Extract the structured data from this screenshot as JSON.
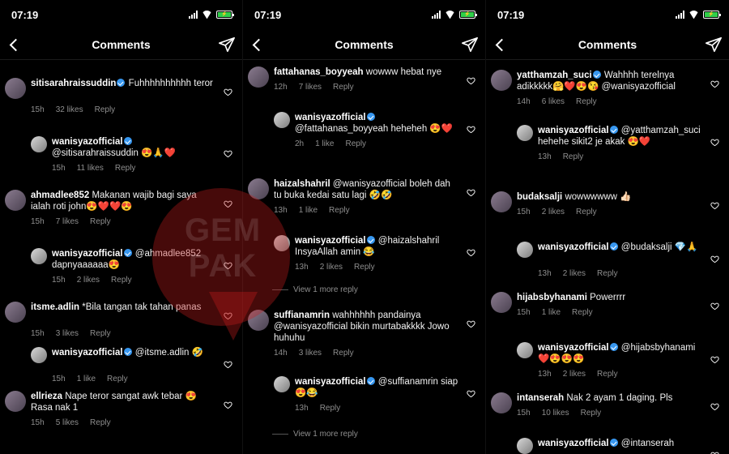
{
  "status": {
    "time": "07:19",
    "battery": "⚡"
  },
  "header": {
    "title": "Comments"
  },
  "watermark": {
    "line1": "GEM",
    "line2": "PAK"
  },
  "panels": [
    {
      "items": [
        {
          "type": "comment",
          "user": "sitisarahraissuddin",
          "verified": true,
          "text": "Fuhhhhhhhhhh teror",
          "time": "15h",
          "likes": "32 likes",
          "reply": "Reply"
        },
        {
          "type": "reply",
          "user": "wanisyazofficial",
          "verified": true,
          "text": "@sitisarahraissuddin 😍🙏❤️",
          "time": "15h",
          "likes": "11 likes",
          "reply": "Reply"
        },
        {
          "type": "comment",
          "user": "ahmadlee852",
          "verified": false,
          "text": "Makanan wajib bagi saya ialah roti john😍❤️❤️😍",
          "time": "15h",
          "likes": "7 likes",
          "reply": "Reply"
        },
        {
          "type": "reply",
          "user": "wanisyazofficial",
          "verified": true,
          "text": "@ahmadlee852 dapnyaaaaaa😍",
          "time": "15h",
          "likes": "2 likes",
          "reply": "Reply"
        },
        {
          "type": "comment",
          "user": "itsme.adlin",
          "verified": false,
          "text": "*Bila tangan tak tahan panas",
          "time": "15h",
          "likes": "3 likes",
          "reply": "Reply"
        },
        {
          "type": "reply",
          "user": "wanisyazofficial",
          "verified": true,
          "text": "@itsme.adlin 🤣",
          "time": "15h",
          "likes": "1 like",
          "reply": "Reply"
        },
        {
          "type": "comment",
          "user": "ellrieza",
          "verified": false,
          "text": "Nape teror sangat awk tebar 😍 Rasa nak 1",
          "time": "15h",
          "likes": "5 likes",
          "reply": "Reply"
        }
      ]
    },
    {
      "items": [
        {
          "type": "comment",
          "user": "fattahanas_boyyeah",
          "verified": false,
          "text": "wowww hebat nye",
          "time": "12h",
          "likes": "7 likes",
          "reply": "Reply"
        },
        {
          "type": "reply",
          "user": "wanisyazofficial",
          "verified": true,
          "text": "@fattahanas_boyyeah heheheh 😍❤️",
          "time": "2h",
          "likes": "1 like",
          "reply": "Reply"
        },
        {
          "type": "comment",
          "user": "haizalshahril",
          "verified": false,
          "text": "@wanisyazofficial  boleh dah tu buka kedai satu lagi 🤣🤣",
          "time": "13h",
          "likes": "1 like",
          "reply": "Reply"
        },
        {
          "type": "reply",
          "user": "wanisyazofficial",
          "verified": true,
          "text": "@haizalshahril InsyaAllah amin 😂",
          "time": "13h",
          "likes": "2 likes",
          "reply": "Reply"
        },
        {
          "type": "viewmore",
          "text": "View 1 more reply"
        },
        {
          "type": "comment",
          "user": "suffianamrin",
          "verified": false,
          "text": "wahhhhhh pandainya @wanisyazofficial bikin murtabakkkk Jowo huhuhu",
          "time": "14h",
          "likes": "3 likes",
          "reply": "Reply"
        },
        {
          "type": "reply",
          "user": "wanisyazofficial",
          "verified": true,
          "text": "@suffianamrin siap 😍😂",
          "time": "13h",
          "likes": "",
          "reply": "Reply"
        },
        {
          "type": "viewmore",
          "text": "View 1 more reply"
        }
      ]
    },
    {
      "items": [
        {
          "type": "comment",
          "user": "yatthamzah_suci",
          "verified": true,
          "text": "Wahhhh terelnya adikkkkk🤗❤️😍😘 @wanisyazofficial",
          "time": "14h",
          "likes": "6 likes",
          "reply": "Reply"
        },
        {
          "type": "reply",
          "user": "wanisyazofficial",
          "verified": true,
          "text": "@yatthamzah_suci hehehe sikit2 je akak 😍❤️",
          "time": "13h",
          "likes": "",
          "reply": "Reply"
        },
        {
          "type": "comment",
          "user": "budaksalji",
          "verified": false,
          "text": "wowwwwww 👍🏻",
          "time": "15h",
          "likes": "2 likes",
          "reply": "Reply"
        },
        {
          "type": "reply",
          "user": "wanisyazofficial",
          "verified": true,
          "text": "@budaksalji 💎🙏",
          "time": "13h",
          "likes": "2 likes",
          "reply": "Reply"
        },
        {
          "type": "comment",
          "user": "hijabsbyhanami",
          "verified": false,
          "text": "Powerrrr",
          "time": "15h",
          "likes": "1 like",
          "reply": "Reply"
        },
        {
          "type": "reply",
          "user": "wanisyazofficial",
          "verified": true,
          "text": "@hijabsbyhanami ❤️😍😍😍",
          "time": "13h",
          "likes": "2 likes",
          "reply": "Reply"
        },
        {
          "type": "comment",
          "user": "intanserah",
          "verified": false,
          "text": "Nak 2 ayam 1 daging. Pls",
          "time": "15h",
          "likes": "10 likes",
          "reply": "Reply"
        },
        {
          "type": "reply",
          "user": "wanisyazofficial",
          "verified": true,
          "text": "@intanserah",
          "time": "",
          "likes": "",
          "reply": ""
        }
      ]
    }
  ]
}
